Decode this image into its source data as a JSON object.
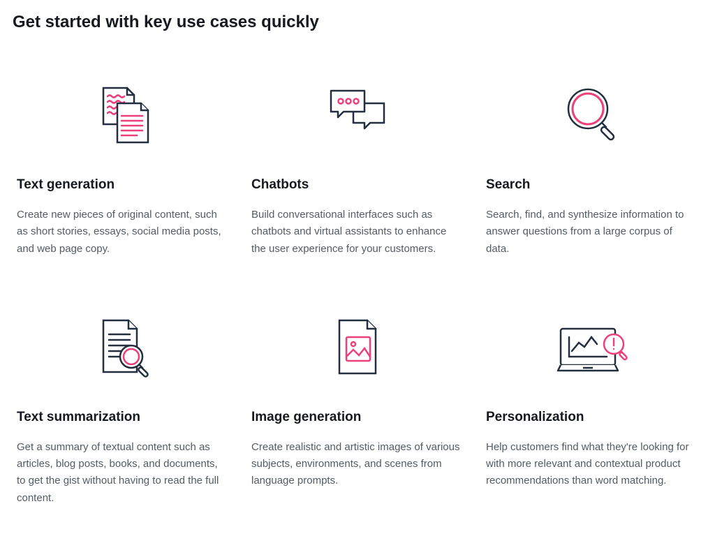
{
  "header": {
    "title": "Get started with key use cases quickly"
  },
  "cards": [
    {
      "icon": "text-generation-icon",
      "title": "Text generation",
      "description": "Create new pieces of original content, such as short stories, essays, social media posts, and web page copy."
    },
    {
      "icon": "chatbots-icon",
      "title": "Chatbots",
      "description": "Build conversational interfaces such as chatbots and virtual assistants to enhance the user experience for your customers."
    },
    {
      "icon": "search-icon",
      "title": "Search",
      "description": "Search, find, and synthesize information to answer questions from a large corpus of data."
    },
    {
      "icon": "text-summarization-icon",
      "title": "Text summarization",
      "description": "Get a summary of textual content such as articles, blog posts, books, and documents, to get the gist without having to read the full content."
    },
    {
      "icon": "image-generation-icon",
      "title": "Image generation",
      "description": "Create realistic and artistic images of various subjects, environments, and scenes from language prompts."
    },
    {
      "icon": "personalization-icon",
      "title": "Personalization",
      "description": "Help customers find what they're looking for with more relevant and contextual product recommendations than word matching."
    }
  ],
  "colors": {
    "accent": "#ec407a",
    "stroke": "#232f3e"
  }
}
